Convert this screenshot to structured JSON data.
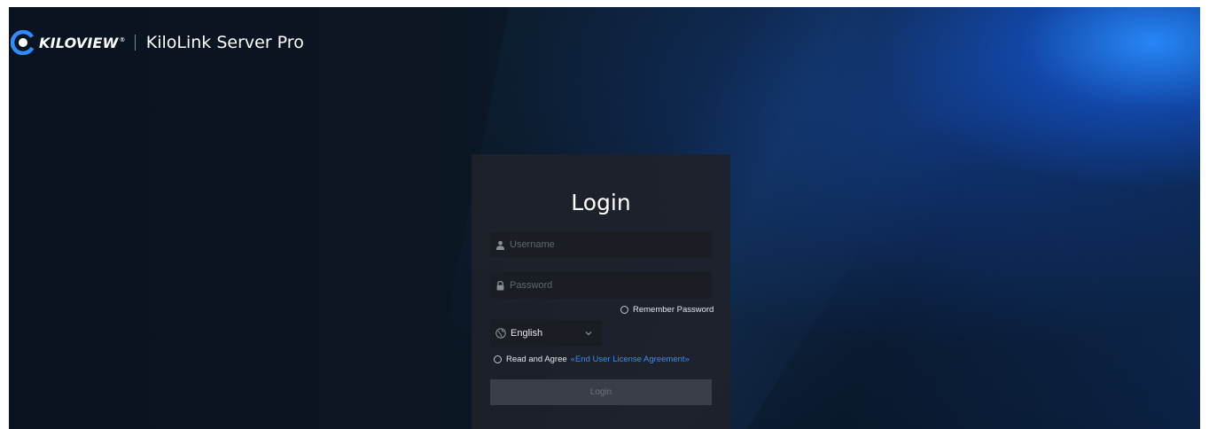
{
  "header": {
    "brand": "KILOVIEW",
    "brand_reg": "®",
    "product": "KiloLink Server Pro"
  },
  "login": {
    "title": "Login",
    "username_placeholder": "Username",
    "password_placeholder": "Password",
    "remember_label": "Remember Password",
    "language_selected": "English",
    "agree_label": "Read and Agree",
    "eula_link": "«End User License Agreement»",
    "login_button": "Login"
  },
  "icons": {
    "logo": "kiloview-logo-icon",
    "user": "user-icon",
    "lock": "lock-icon",
    "globe": "globe-icon",
    "chevron": "chevron-down-icon"
  },
  "colors": {
    "accent_link": "#3b8bff",
    "panel_bg": "#1e222a",
    "button_disabled": "#3a3e46"
  }
}
